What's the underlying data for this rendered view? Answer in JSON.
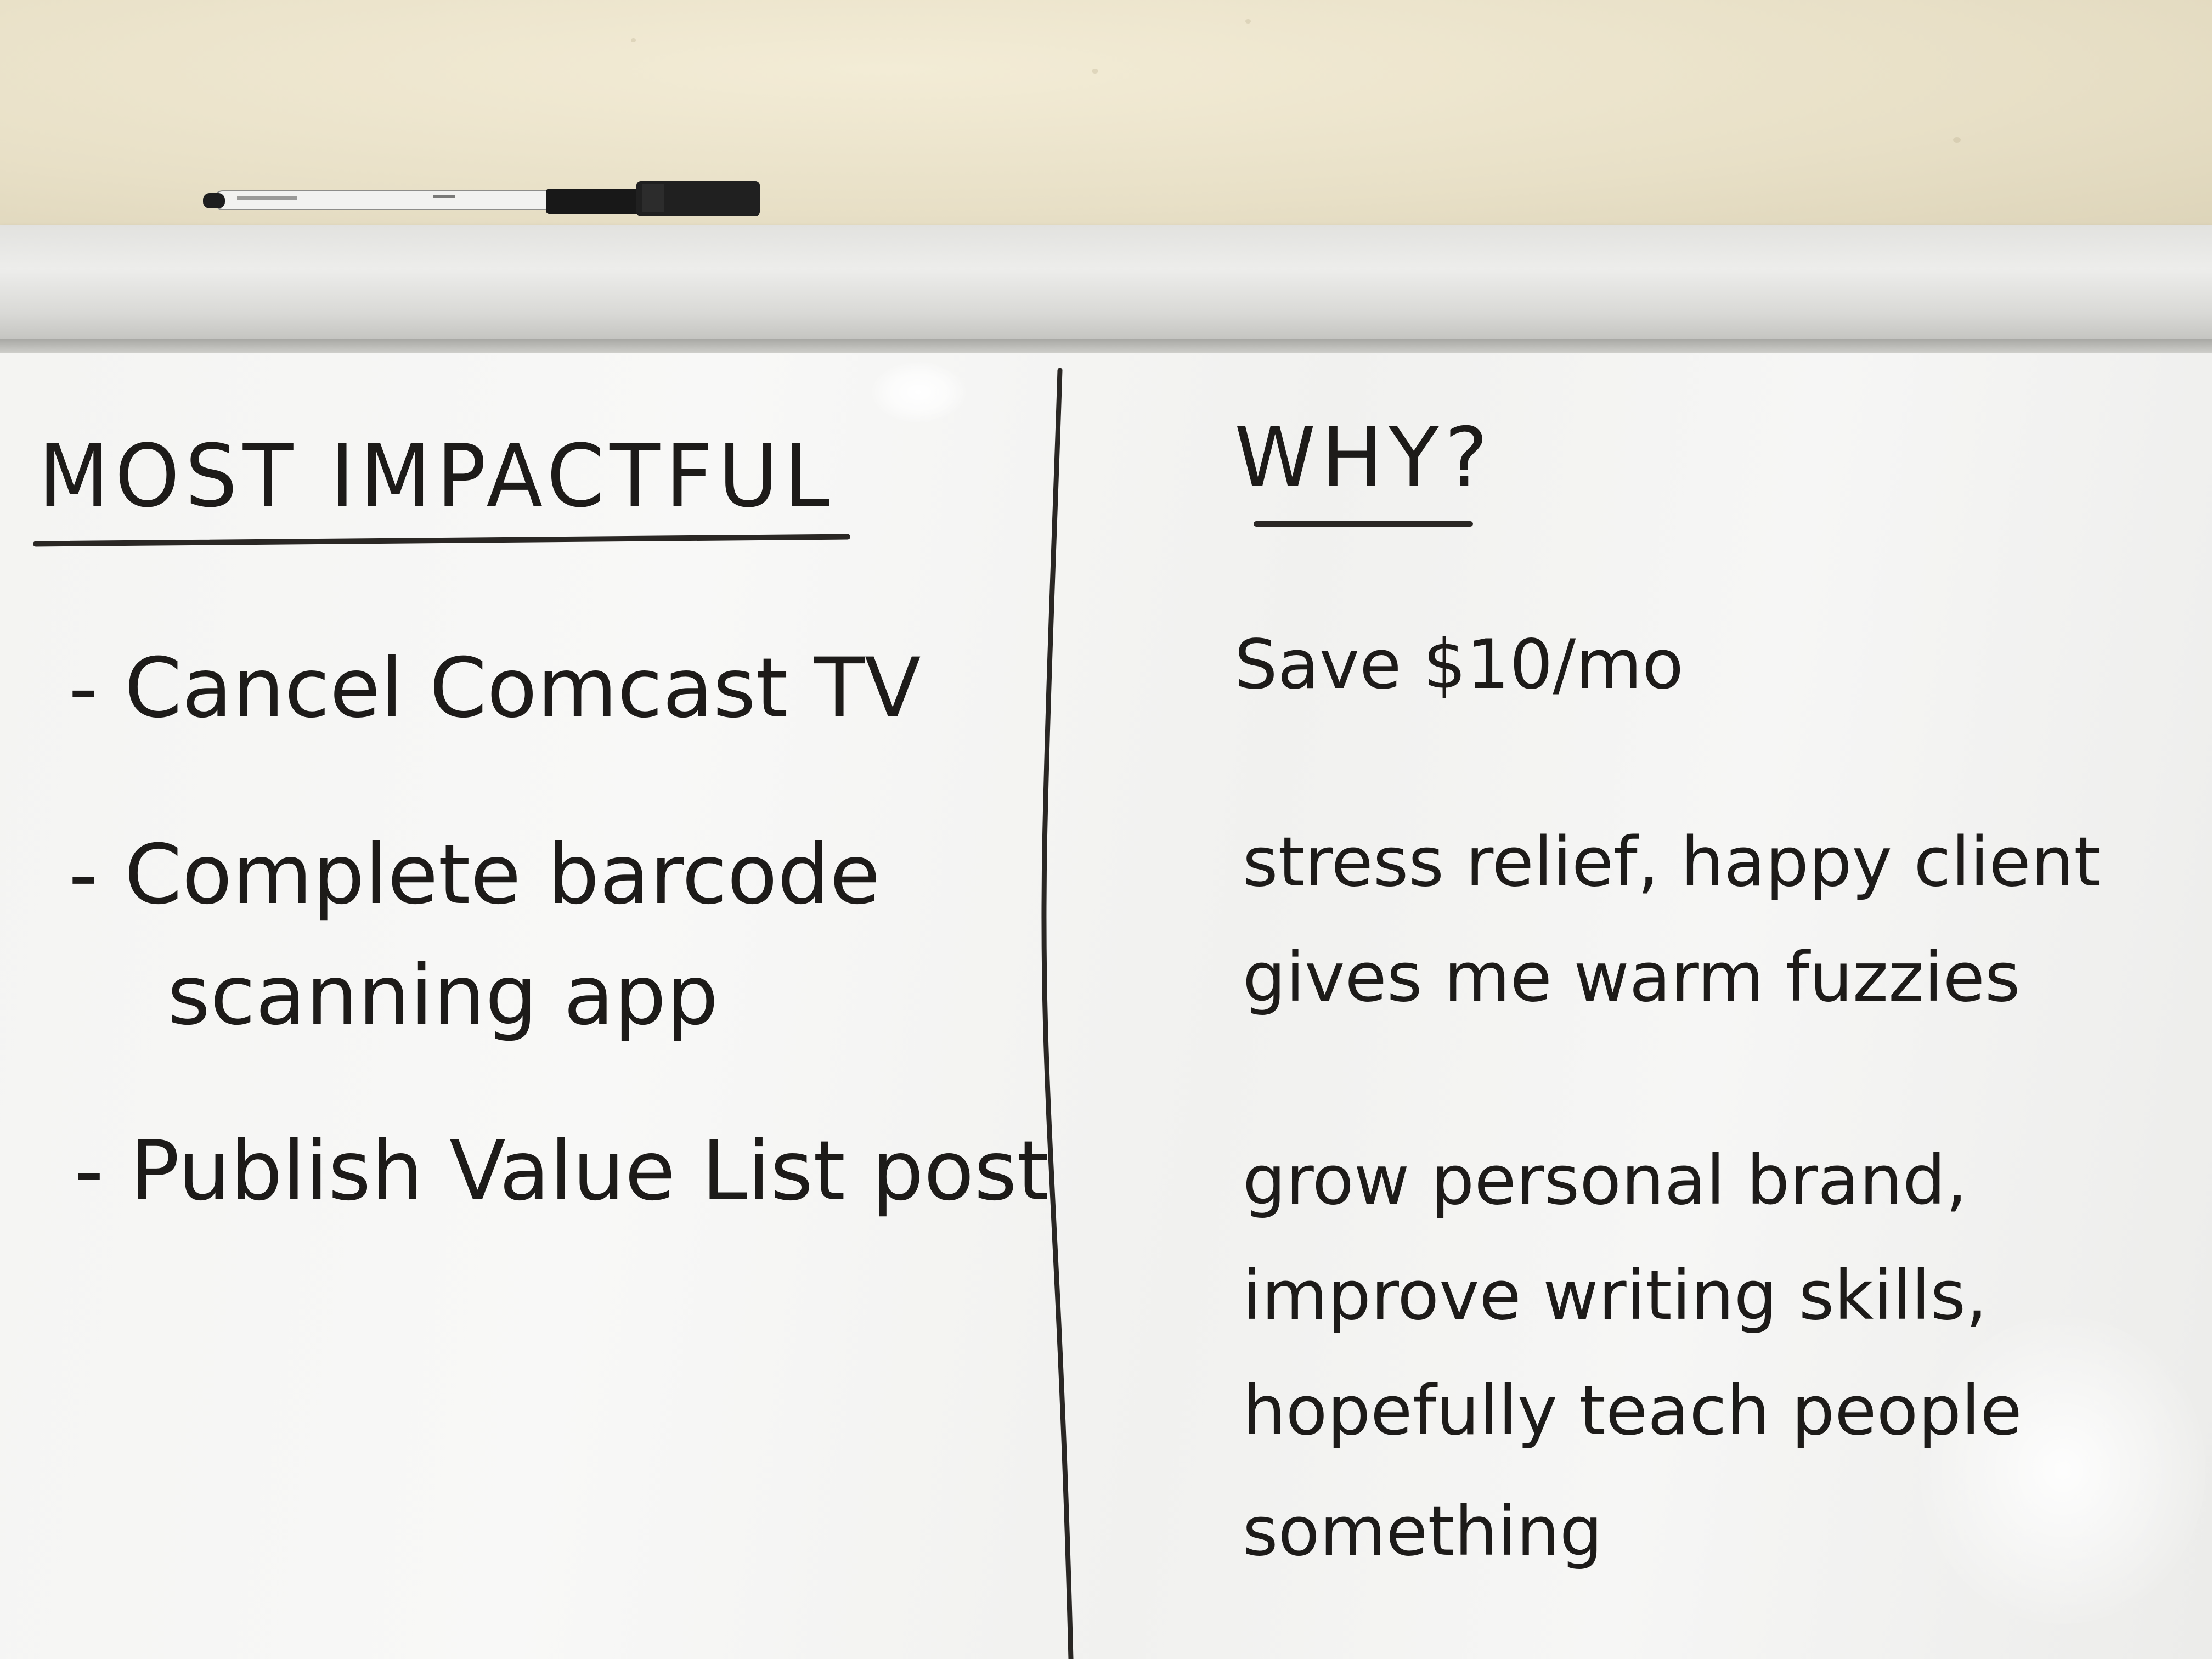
{
  "board": {
    "left_heading": "MOST IMPACTFUL",
    "right_heading": "WHY?",
    "items": [
      "- Cancel Comcast TV",
      "- Complete barcode",
      "scanning app",
      "- Publish Value List post"
    ],
    "reasons": [
      "Save $10/mo",
      "stress relief, happy client",
      "gives me warm fuzzies",
      "grow personal brand,",
      "improve writing skills,",
      "hopefully teach people",
      "something"
    ]
  },
  "colors": {
    "wall": "#e9e2cd",
    "board": "#f4f4f2",
    "frame": "#e2e2df",
    "ink": "#1d1b19"
  }
}
